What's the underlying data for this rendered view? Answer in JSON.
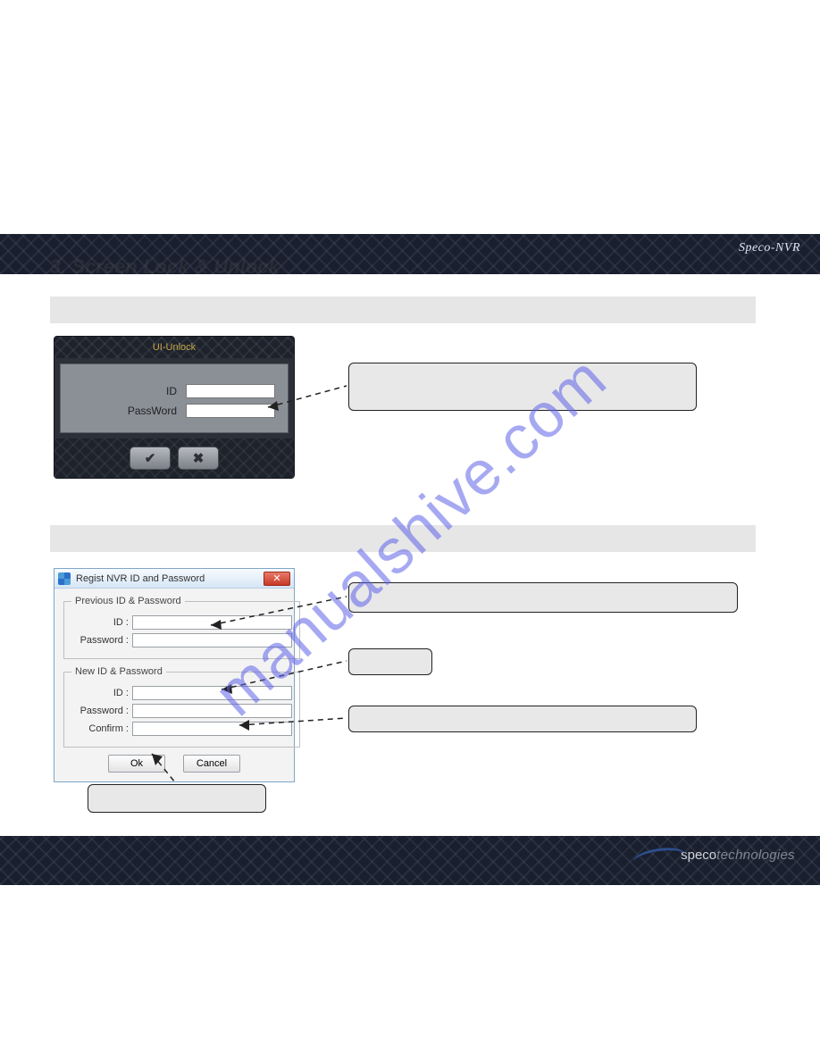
{
  "brand_top": "Speco-NVR",
  "logo_bold": "speco",
  "logo_light": "technologies",
  "page_heading": "3. Screen Lock & Unlock",
  "unlock": {
    "title": "UI-Unlock",
    "id_label": "ID",
    "pw_label": "PassWord",
    "ok_symbol": "✔",
    "cancel_symbol": "✖"
  },
  "regist": {
    "window_title": "Regist NVR ID and Password",
    "close_symbol": "✕",
    "group_prev": "Previous ID & Password",
    "group_new": "New ID & Password",
    "id_label": "ID :",
    "pw_label": "Password :",
    "confirm_label": "Confirm :",
    "ok_label": "Ok",
    "cancel_label": "Cancel"
  },
  "watermark_text": "manualshive.com"
}
